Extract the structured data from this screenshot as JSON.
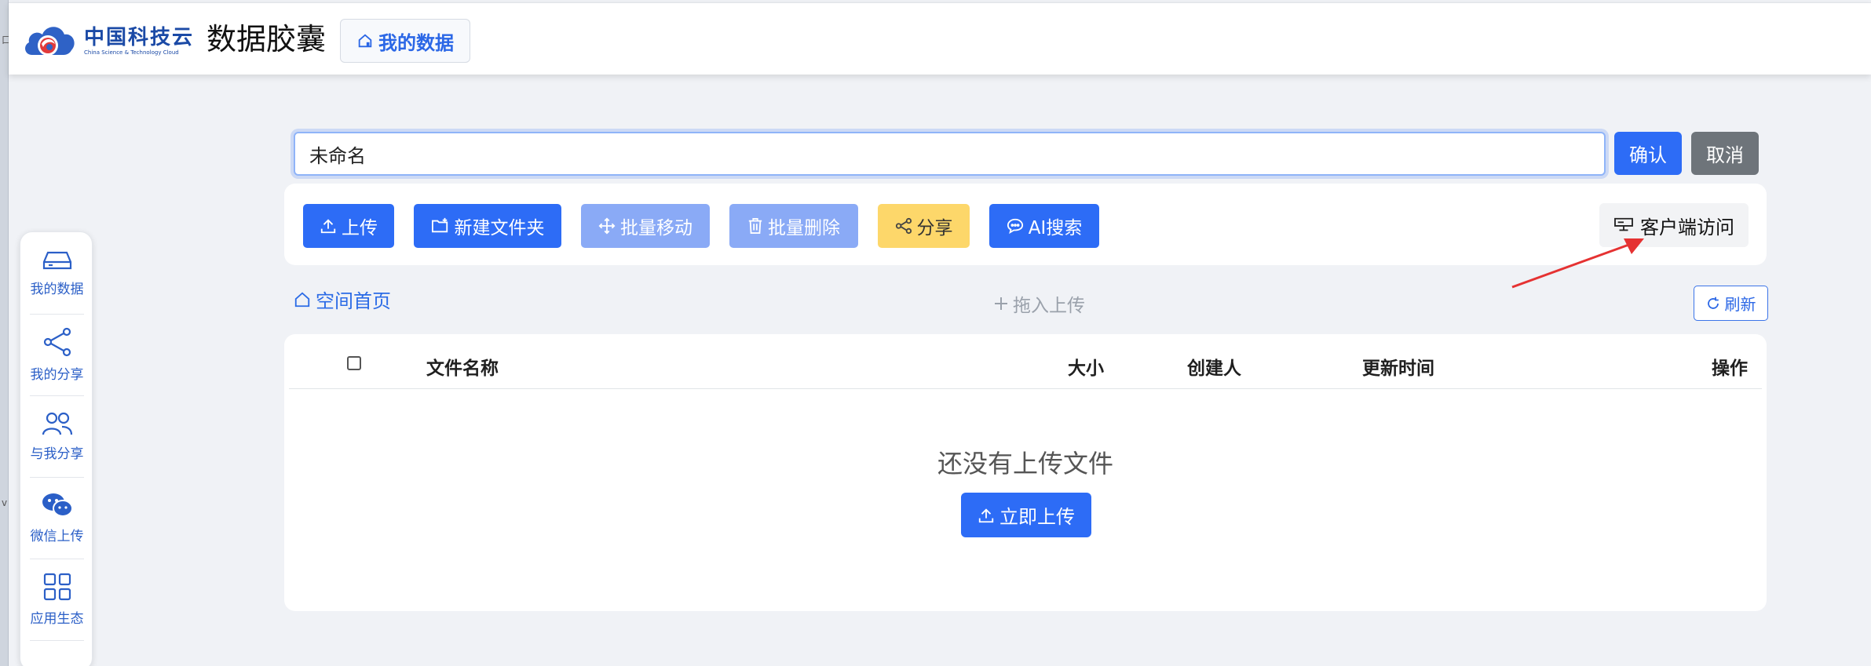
{
  "header": {
    "logo_cn": "中国科技云",
    "logo_en": "China Science & Technology Cloud",
    "app_title": "数据胶囊",
    "my_data_button": "我的数据"
  },
  "sidebar": {
    "items": [
      {
        "label": "我的数据",
        "icon": "drive-icon"
      },
      {
        "label": "我的分享",
        "icon": "share-icon"
      },
      {
        "label": "与我分享",
        "icon": "users-icon"
      },
      {
        "label": "微信上传",
        "icon": "wechat-icon"
      },
      {
        "label": "应用生态",
        "icon": "grid-icon"
      }
    ]
  },
  "rename": {
    "value": "未命名",
    "confirm_label": "确认",
    "cancel_label": "取消"
  },
  "toolbar": {
    "upload": "上传",
    "new_folder": "新建文件夹",
    "batch_move": "批量移动",
    "batch_delete": "批量删除",
    "share": "分享",
    "ai_search": "AI搜索",
    "client_access": "客户端访问"
  },
  "nav": {
    "breadcrumb": "空间首页",
    "drop_upload": "拖入上传",
    "refresh": "刷新"
  },
  "table": {
    "columns": [
      "文件名称",
      "大小",
      "创建人",
      "更新时间",
      "操作"
    ],
    "empty_text": "还没有上传文件",
    "upload_now": "立即上传"
  },
  "colors": {
    "primary": "#2d6cf6",
    "primary_disabled": "#8aaaf6",
    "share_yellow": "#fdd76a",
    "cancel_gray": "#6e747a",
    "annotation_red": "#e53232"
  }
}
